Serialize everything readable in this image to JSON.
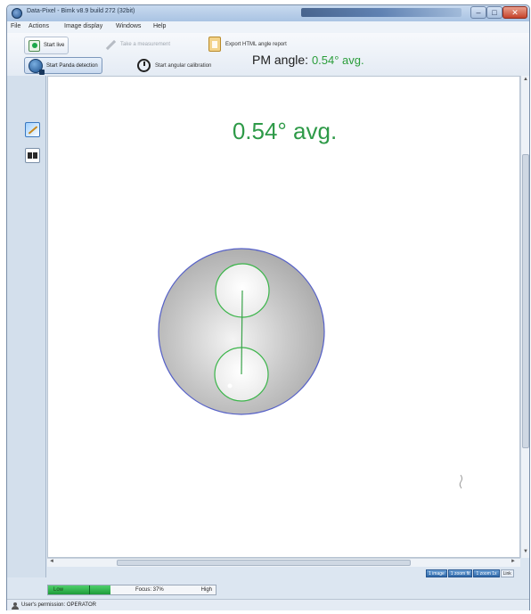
{
  "window": {
    "title": "Data-Pixel - Bimk v8.9 build 272 (32bit)",
    "buttons": {
      "minimize": "–",
      "maximize": "□",
      "close": "✕"
    }
  },
  "menu": [
    "File",
    "Actions",
    "Image display",
    "Windows",
    "Help"
  ],
  "toolbar": {
    "start_live": "Start live",
    "take_measurement": "Take a measurement",
    "export_report": "Export HTML angle report",
    "start_panda_detection": "Start Panda detection",
    "start_angular_calibration": "Start angular calibration",
    "pm_angle_label": "PM angle:",
    "pm_angle_value": "0.54° avg."
  },
  "viewport": {
    "angle_display": "0.54° avg.",
    "accent_color": "#2e9a48",
    "fiber_outline_color": "#5560c8",
    "stress_rod_outline_color": "#3bb54a"
  },
  "scrollbars": {
    "up": "▲",
    "down": "▼",
    "left": "◄",
    "right": "►"
  },
  "zoom_buttons": [
    "1 image",
    "1 zoom fit",
    "1 zoom 1x",
    "Link"
  ],
  "focus": {
    "low_label": "Low",
    "focus_label": "Focus: 37%",
    "high_label": "High",
    "level_percent": 37
  },
  "status": {
    "permission": "User's permission: OPERATOR"
  },
  "icons": {
    "app": "app-icon",
    "live": "live-icon",
    "measure": "pencil-icon",
    "export": "clipboard-icon",
    "detect": "target-icon",
    "calibrate": "stopwatch-icon",
    "user": "user-icon"
  }
}
